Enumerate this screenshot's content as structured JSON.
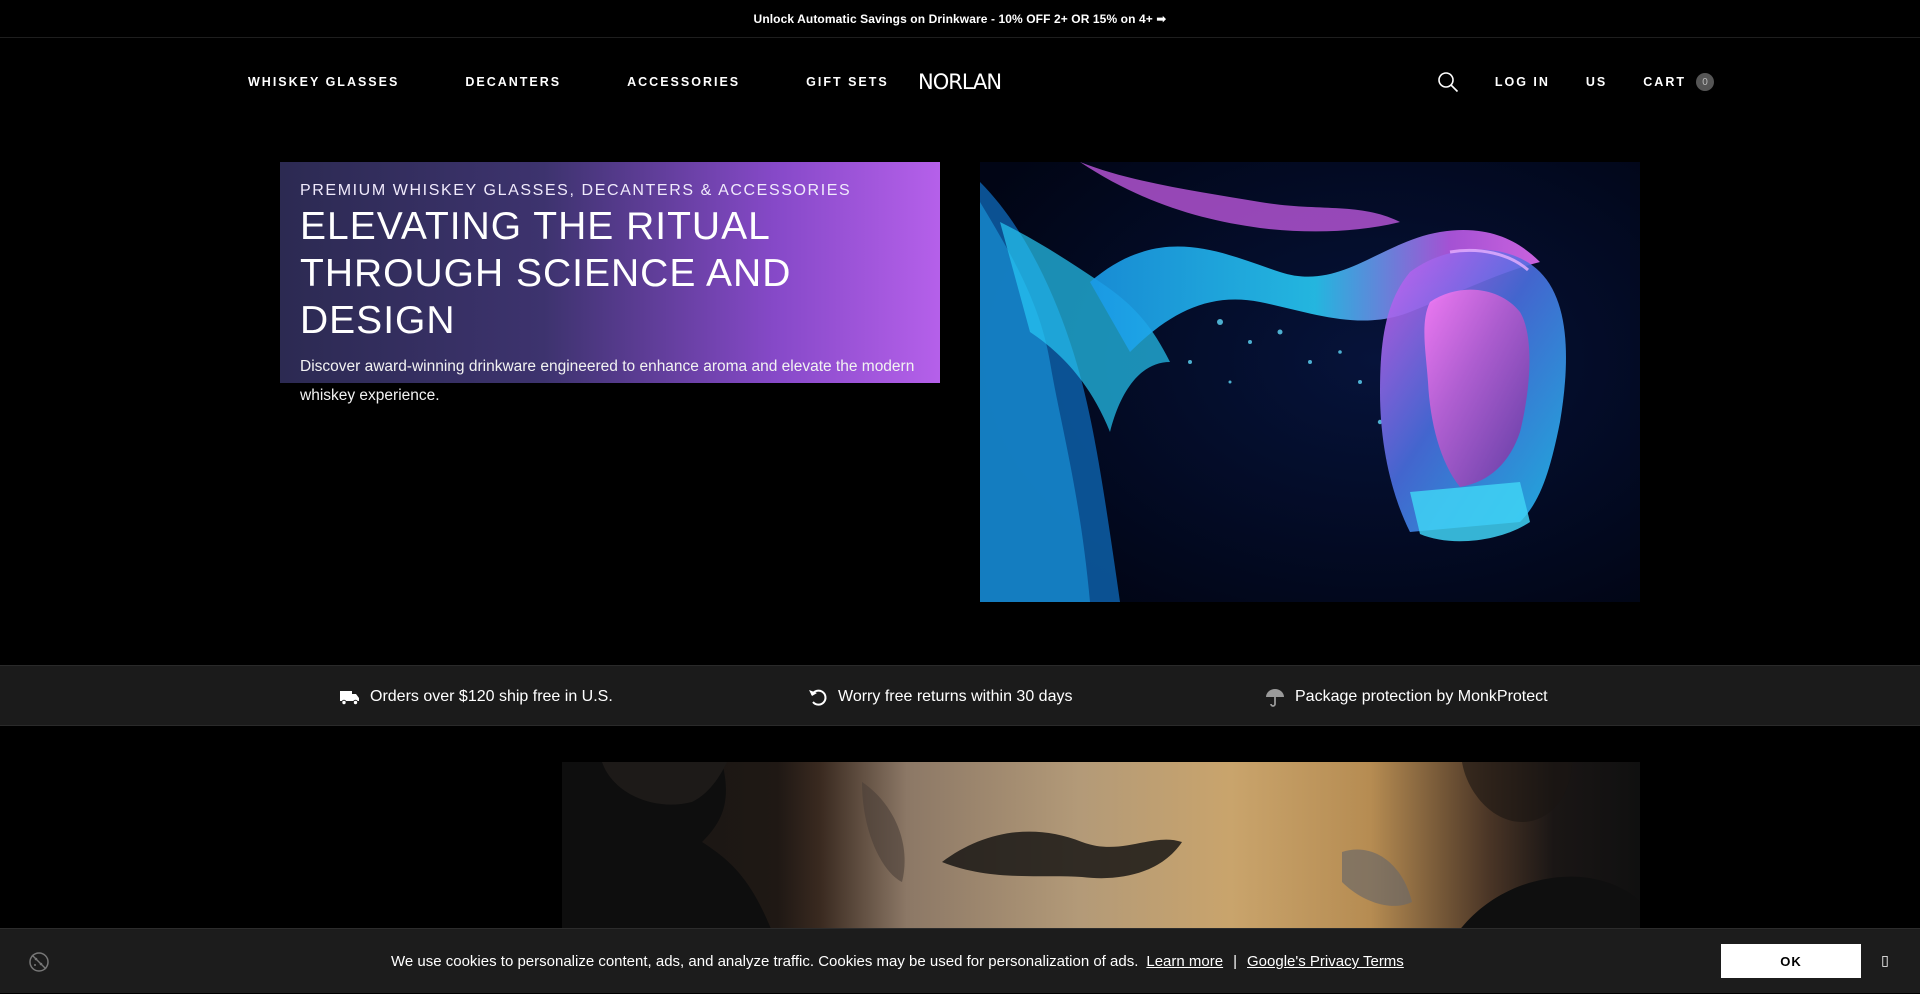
{
  "announcement": "Unlock Automatic Savings on Drinkware - 10% OFF 2+ OR 15% on 4+ ➡",
  "nav": {
    "left": [
      "WHISKEY GLASSES",
      "DECANTERS",
      "ACCESSORIES",
      "GIFT SETS"
    ],
    "logo": "NORLAN",
    "login": "LOG IN",
    "region": "US",
    "cart": "CART",
    "cart_count": "0"
  },
  "hero": {
    "eyebrow": "PREMIUM WHISKEY GLASSES, DECANTERS & ACCESSORIES",
    "title": "ELEVATING THE RITUAL THROUGH SCIENCE AND DESIGN",
    "description": "Discover award-winning drinkware engineered to enhance aroma and elevate the modern whiskey experience."
  },
  "benefits": [
    {
      "icon": "truck-icon",
      "text": "Orders over $120 ship free in U.S."
    },
    {
      "icon": "return-icon",
      "text": "Worry free returns within 30 days"
    },
    {
      "icon": "umbrella-icon",
      "text": "Package protection by MonkProtect"
    }
  ],
  "cookie": {
    "text": "We use cookies to personalize content, ads, and analyze traffic. Cookies may be used for personalization of ads.",
    "learn_more": "Learn more",
    "separator": "|",
    "privacy": "Google's Privacy Terms",
    "ok": "OK",
    "close": "▯"
  },
  "colors": {
    "hero_gradient_start": "#2c2a52",
    "hero_gradient_end": "#b560ea",
    "benefits_bg": "#1b1b1b",
    "cookie_bg": "#1c1c1c"
  }
}
